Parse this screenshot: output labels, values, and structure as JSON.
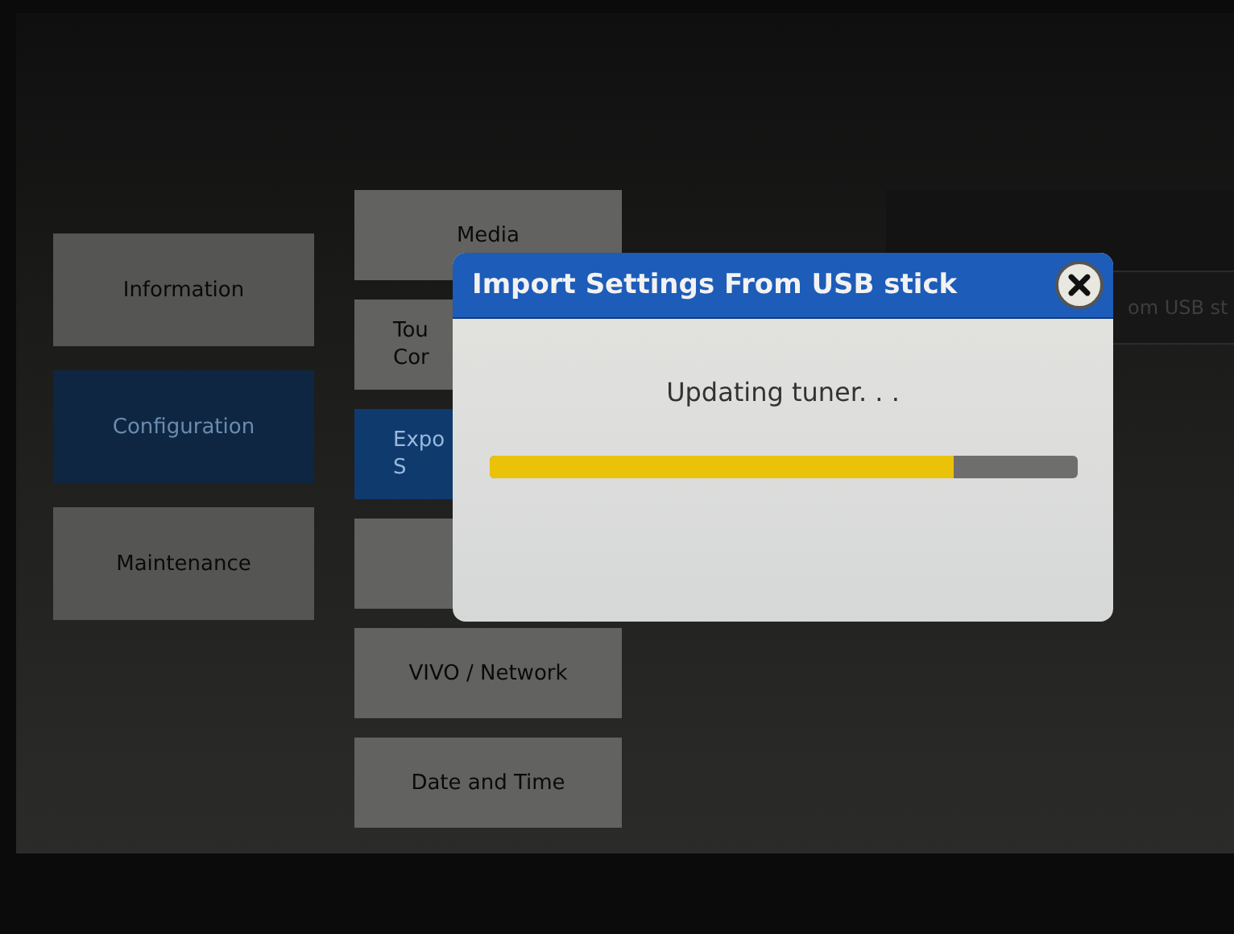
{
  "sidebar": {
    "items": [
      {
        "label": "Information",
        "selected": false
      },
      {
        "label": "Configuration",
        "selected": true
      },
      {
        "label": "Maintenance",
        "selected": false
      }
    ]
  },
  "menu": {
    "items": [
      {
        "lines": [
          "Media"
        ],
        "selected": false
      },
      {
        "lines": [
          "Tou",
          "Cor"
        ],
        "selected": false
      },
      {
        "lines": [
          "Expo",
          "S"
        ],
        "selected": true
      },
      {
        "selected": false
      },
      {
        "lines": [
          "VIVO / Network"
        ],
        "selected": false
      },
      {
        "lines": [
          "Date and Time"
        ],
        "selected": false
      }
    ]
  },
  "right_panel": {
    "rows": [
      "om USB st"
    ]
  },
  "dialog": {
    "title": "Import Settings From USB stick",
    "message": "Updating tuner. . .",
    "progress": {
      "level": 0.79
    }
  }
}
